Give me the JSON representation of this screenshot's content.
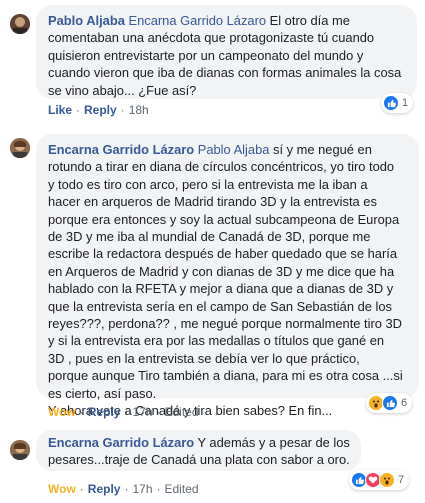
{
  "comments": [
    {
      "author": "Pablo Aljaba",
      "mention": "Encarna Garrido Lázaro",
      "lines": [
        " El otro día me",
        "comentaban una anécdota que protagonizaste tú cuando",
        "quisieron entrevistarte por un campeonato del mundo y",
        "cuando vieron que iba de dianas con formas animales la cosa",
        "se vino abajo... ¿Fue así?"
      ],
      "actions": {
        "react": "Like",
        "reply": "Reply",
        "time": "18h",
        "edited": ""
      },
      "reactions": {
        "icons": [
          "like-icon"
        ],
        "count": "1"
      }
    },
    {
      "author": "Encarna Garrido Lázaro",
      "mention": "Pablo Aljaba",
      "lines": [
        " sí y me negué en",
        "rotundo a tirar en diana de círculos concéntricos, yo tiro todo",
        "y todo es tiro con arco, pero si la entrevista me la iban a",
        "hacer en arqueros de Madrid tirando 3D y la entrevista es",
        "porque era entonces y soy la actual subcampeona de Europa",
        "de 3D y me iba al mundial de Canadá de 3D, porque me",
        "escribe la redactora después de haber quedado que se haría",
        "en Arqueros de Madrid y con dianas de 3D y me dice que ha",
        "hablado con la RFETA y mejor a diana que a dianas de 3D y",
        "que la entrevista sería en el campo de San Sebastián de los",
        "reyes???, perdona?? , me negué porque normalmente tiro 3D",
        "y si la entrevista era por las medallas o títulos que gané en",
        "3D , pues en la entrevista se debía ver lo que práctico,",
        "porque aunque Tiro también a diana, para mi es otra cosa ...si",
        "es cierto, así paso.",
        "Y ahora vete a Canadá y tira bien sabes? En fin..."
      ],
      "actions": {
        "react": "Wow",
        "reply": "Reply",
        "time": "17h",
        "edited": "Edited"
      },
      "reactions": {
        "icons": [
          "wow-icon",
          "like-icon"
        ],
        "count": "6"
      }
    },
    {
      "author": "Encarna Garrido Lázaro",
      "mention": "",
      "lines": [
        " Y además y a pesar de los",
        "pesares...traje de Canadá una plata con sabor a oro."
      ],
      "actions": {
        "react": "Wow",
        "reply": "Reply",
        "time": "17h",
        "edited": "Edited"
      },
      "reactions": {
        "icons": [
          "like-icon",
          "love-icon",
          "wow-icon"
        ],
        "count": "7"
      }
    }
  ],
  "colors": {
    "link": "#385898",
    "bubble": "#f2f3f5",
    "wow": "#f7b125",
    "like": "#1877f2",
    "love": "#f33e58",
    "meta": "#606770"
  }
}
